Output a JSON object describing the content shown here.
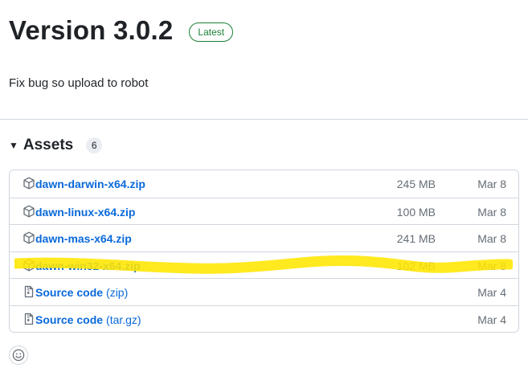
{
  "release": {
    "title": "Version 3.0.2",
    "badge": "Latest",
    "description": "Fix bug so upload to robot"
  },
  "assets": {
    "label": "Assets",
    "count": "6",
    "items": [
      {
        "name": "dawn-darwin-x64.zip",
        "suffix": "",
        "size": "245 MB",
        "date": "Mar 8",
        "icon": "package-icon"
      },
      {
        "name": "dawn-linux-x64.zip",
        "suffix": "",
        "size": "100 MB",
        "date": "Mar 8",
        "icon": "package-icon"
      },
      {
        "name": "dawn-mas-x64.zip",
        "suffix": "",
        "size": "241 MB",
        "date": "Mar 8",
        "icon": "package-icon"
      },
      {
        "name": "dawn-win32-x64.zip",
        "suffix": "",
        "size": "102 MB",
        "date": "Mar 8",
        "icon": "package-icon"
      },
      {
        "name": "Source code",
        "suffix": "(zip)",
        "size": "",
        "date": "Mar 4",
        "icon": "file-zip-icon"
      },
      {
        "name": "Source code",
        "suffix": "(tar.gz)",
        "size": "",
        "date": "Mar 4",
        "icon": "file-zip-icon"
      }
    ]
  },
  "colors": {
    "link": "#0969da",
    "badge_green": "#1a7f37",
    "highlight": "#ffe600",
    "muted": "#656d76"
  }
}
